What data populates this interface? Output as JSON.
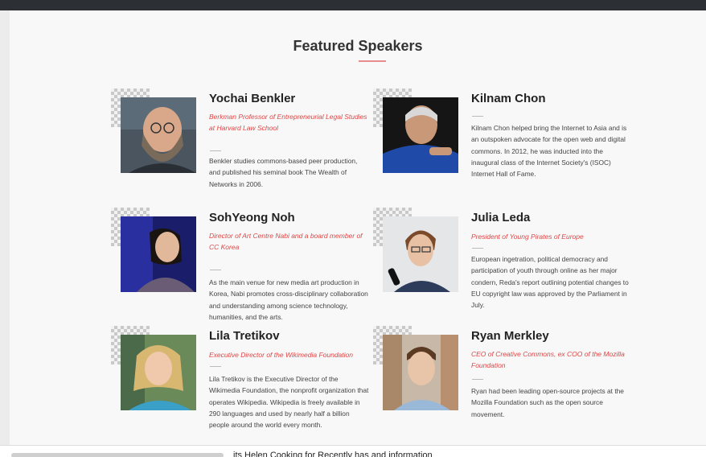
{
  "section": {
    "title": "Featured Speakers"
  },
  "speakers": [
    {
      "name": "Yochai Benkler",
      "role": "Berkman Professor of Entrepreneurial Legal Studies at Harvard Law School",
      "bio": "Benkler studies commons-based peer production, and published his seminal book The Wealth of Networks in 2006."
    },
    {
      "name": "Kilnam Chon",
      "role": "",
      "bio": "Kilnam Chon helped bring the Internet to Asia and is an outspoken advocate for the open web and digital commons. In 2012, he was inducted into the inaugural class of the Internet Society's (ISOC) Internet Hall of Fame."
    },
    {
      "name": "SohYeong Noh",
      "role": "Director of Art Centre Nabi and a board member of CC Korea",
      "bio": "As the main venue for new media art production in Korea, Nabi promotes cross-disciplinary collaboration and understanding among science technology, humanities, and the arts."
    },
    {
      "name": "Julia Leda",
      "role": "President of Young Pirates of Europe",
      "bio": "European ingetration, political democracy and participation of youth through online as her major condern, Reda's report outlining potential changes to EU copyright law was approved by the Parliament in July."
    },
    {
      "name": "Lila Tretikov",
      "role": "Executive Director of the Wikimedia Foundation",
      "bio": "Lila Tretikov is the Executive Director of the Wikimedia Foundation, the nonprofit organization that operates Wikipedia. Wikipedia is freely available in 290 languages and used by nearly half a billion people around the world every month."
    },
    {
      "name": "Ryan Merkley",
      "role": "CEO of Creative Commons, ex COO of the Mozilla Foundation",
      "bio": "Ryan had been leading open-source projects at the Mozilla Foundation such as the open source movement."
    }
  ],
  "footer": {
    "partial_text": "its   Helen   Cooking   for        Recently       has         and information"
  },
  "colors": {
    "accent": "#e04545",
    "topbar": "#2c2f33"
  }
}
